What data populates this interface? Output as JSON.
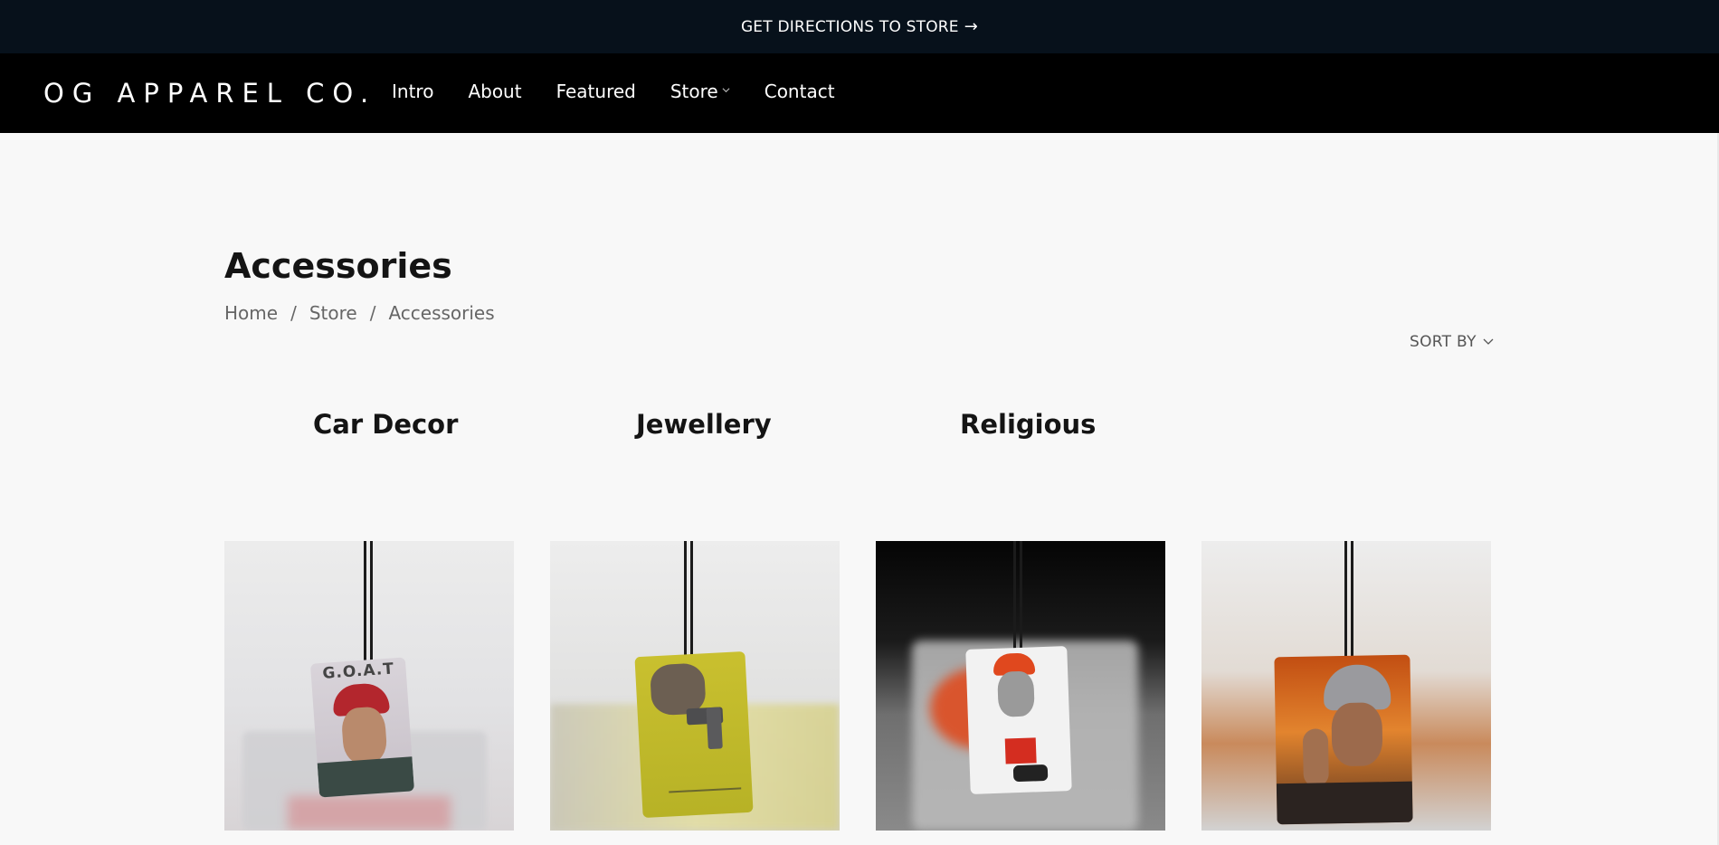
{
  "announcement": {
    "text": "GET DIRECTIONS TO STORE",
    "arrow": "→"
  },
  "header": {
    "logo": "OG APPAREL CO.",
    "nav": [
      {
        "label": "Intro"
      },
      {
        "label": "About"
      },
      {
        "label": "Featured"
      },
      {
        "label": "Store",
        "has_dropdown": true
      },
      {
        "label": "Contact"
      }
    ]
  },
  "page": {
    "title": "Accessories",
    "breadcrumb": [
      "Home",
      "Store",
      "Accessories"
    ],
    "sort_label": "SORT BY",
    "categories": [
      "Car Decor",
      "Jewellery",
      "Religious"
    ]
  },
  "products": [
    {
      "icon": "goat-air-freshener-image",
      "tag_text": "G.O.A.T"
    },
    {
      "icon": "hand-gun-air-freshener-image",
      "tag_text": ""
    },
    {
      "icon": "legend-air-freshener-image",
      "tag_text": ""
    },
    {
      "icon": "praying-man-air-freshener-image",
      "tag_text": ""
    }
  ],
  "colors": {
    "announcement_bg": "#07111b",
    "nav_bg": "#000000",
    "page_bg": "#f8f8f8",
    "text": "#141414"
  }
}
